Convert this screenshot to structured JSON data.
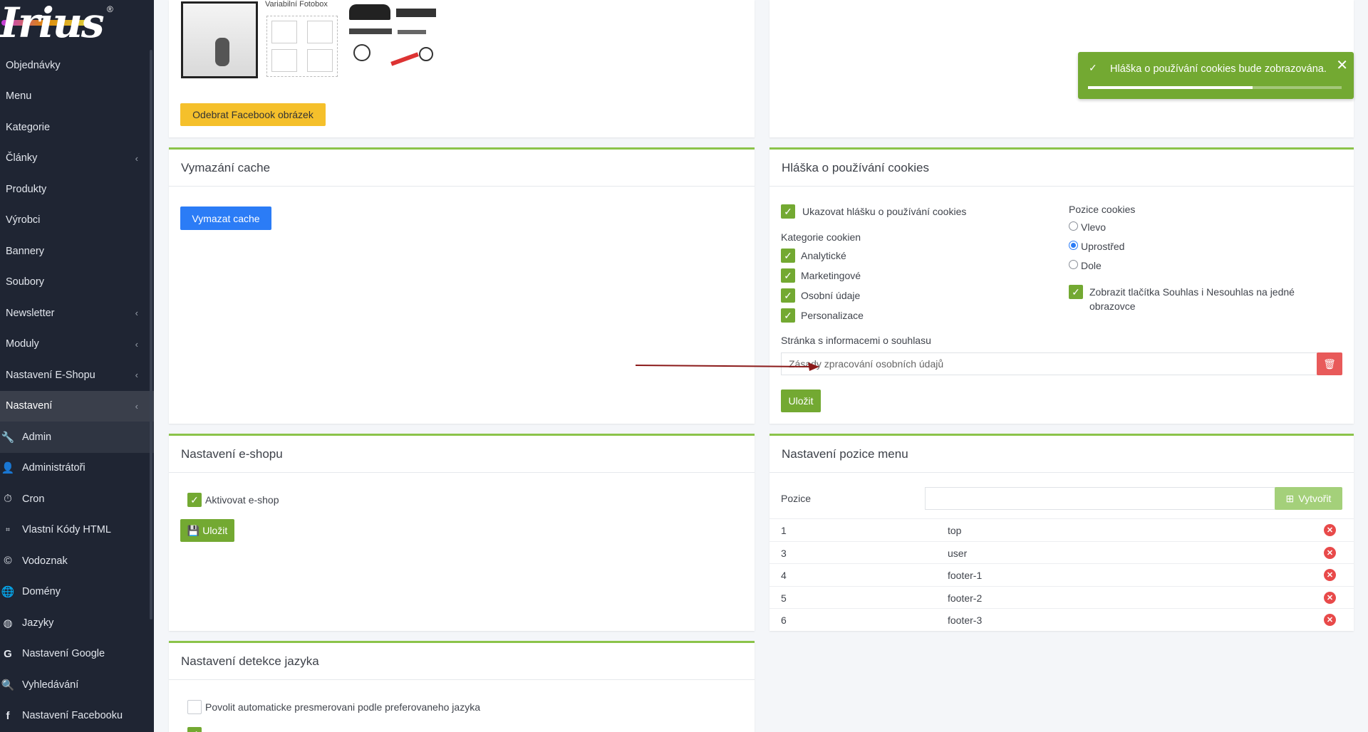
{
  "brand": {
    "logo_text": "Irius",
    "reg_mark": "®"
  },
  "sidebar": {
    "items": [
      {
        "label": "Objednávky",
        "chevron": false
      },
      {
        "label": "Menu",
        "chevron": false
      },
      {
        "label": "Kategorie",
        "chevron": false
      },
      {
        "label": "Články",
        "chevron": true
      },
      {
        "label": "Produkty",
        "chevron": false
      },
      {
        "label": "Výrobci",
        "chevron": false
      },
      {
        "label": "Bannery",
        "chevron": false
      },
      {
        "label": "Soubory",
        "chevron": false
      },
      {
        "label": "Newsletter",
        "chevron": true
      },
      {
        "label": "Moduly",
        "chevron": true
      },
      {
        "label": "Nastavení E-Shopu",
        "chevron": true
      },
      {
        "label": "Nastavení",
        "chevron": true
      }
    ],
    "subitems": [
      {
        "label": "Admin",
        "icon": "wrench-icon"
      },
      {
        "label": "Administrátoři",
        "icon": "user-icon"
      },
      {
        "label": "Cron",
        "icon": "stopwatch-icon"
      },
      {
        "label": "Vlastní Kódy HTML",
        "icon": "html-icon"
      },
      {
        "label": "Vodoznak",
        "icon": "copyright-icon"
      },
      {
        "label": "Domény",
        "icon": "globe-icon"
      },
      {
        "label": "Jazyky",
        "icon": "language-icon"
      },
      {
        "label": "Nastavení Google",
        "icon": "google-icon"
      },
      {
        "label": "Vyhledávání",
        "icon": "search-icon"
      },
      {
        "label": "Nastavení Facebooku",
        "icon": "facebook-icon"
      }
    ],
    "chevron_glyph": "‹"
  },
  "facebook_card": {
    "image_caption": "Variabilní Fotobox",
    "remove_button": "Odebrat Facebook obrázek"
  },
  "cache_card": {
    "title": "Vymazání cache",
    "button": "Vymazat cache"
  },
  "eshop_card": {
    "title": "Nastavení e-shopu",
    "activate_label": "Aktivovat e-shop",
    "save_button": "Uložit"
  },
  "lang_card": {
    "title": "Nastavení detekce jazyka",
    "redirect_label": "Povolit automaticke presmerovani podle preferovaneho jazyka"
  },
  "cookies_card": {
    "title": "Hláška o používání cookies",
    "show_label": "Ukazovat hlášku o používání cookies",
    "categories_label": "Kategorie cookien",
    "categories": [
      "Analytické",
      "Marketingové",
      "Osobní údaje",
      "Personalizace"
    ],
    "position_label": "Pozice cookies",
    "positions": [
      "Vlevo",
      "Uprostřed",
      "Dole"
    ],
    "selected_position": "Uprostřed",
    "both_buttons_label_1": "Zobrazit tlačítka Souhlas i Nesouhlas na jedné",
    "both_buttons_label_2": "obrazovce",
    "consent_page_label": "Stránka s informacemi o souhlasu",
    "consent_page_value": "Zásady zpracování osobních údajů",
    "save_button": "Uložit"
  },
  "menu_card": {
    "title": "Nastavení pozice menu",
    "position_label": "Pozice",
    "position_placeholder": "",
    "create_button": "Vytvořit",
    "rows": [
      {
        "id": "1",
        "name": "top"
      },
      {
        "id": "3",
        "name": "user"
      },
      {
        "id": "4",
        "name": "footer-1"
      },
      {
        "id": "5",
        "name": "footer-2"
      },
      {
        "id": "6",
        "name": "footer-3"
      }
    ]
  },
  "toast": {
    "message": "Hláška o používání cookies bude zobrazována.",
    "progress": 0.65
  },
  "colors": {
    "accent_green": "#73a932",
    "sidebar_bg": "#1f2533",
    "primary_blue": "#2b7cf6",
    "warning_yellow": "#f5c02b",
    "danger_red": "#e85a5a",
    "arrow_red": "#8b1a1a"
  }
}
